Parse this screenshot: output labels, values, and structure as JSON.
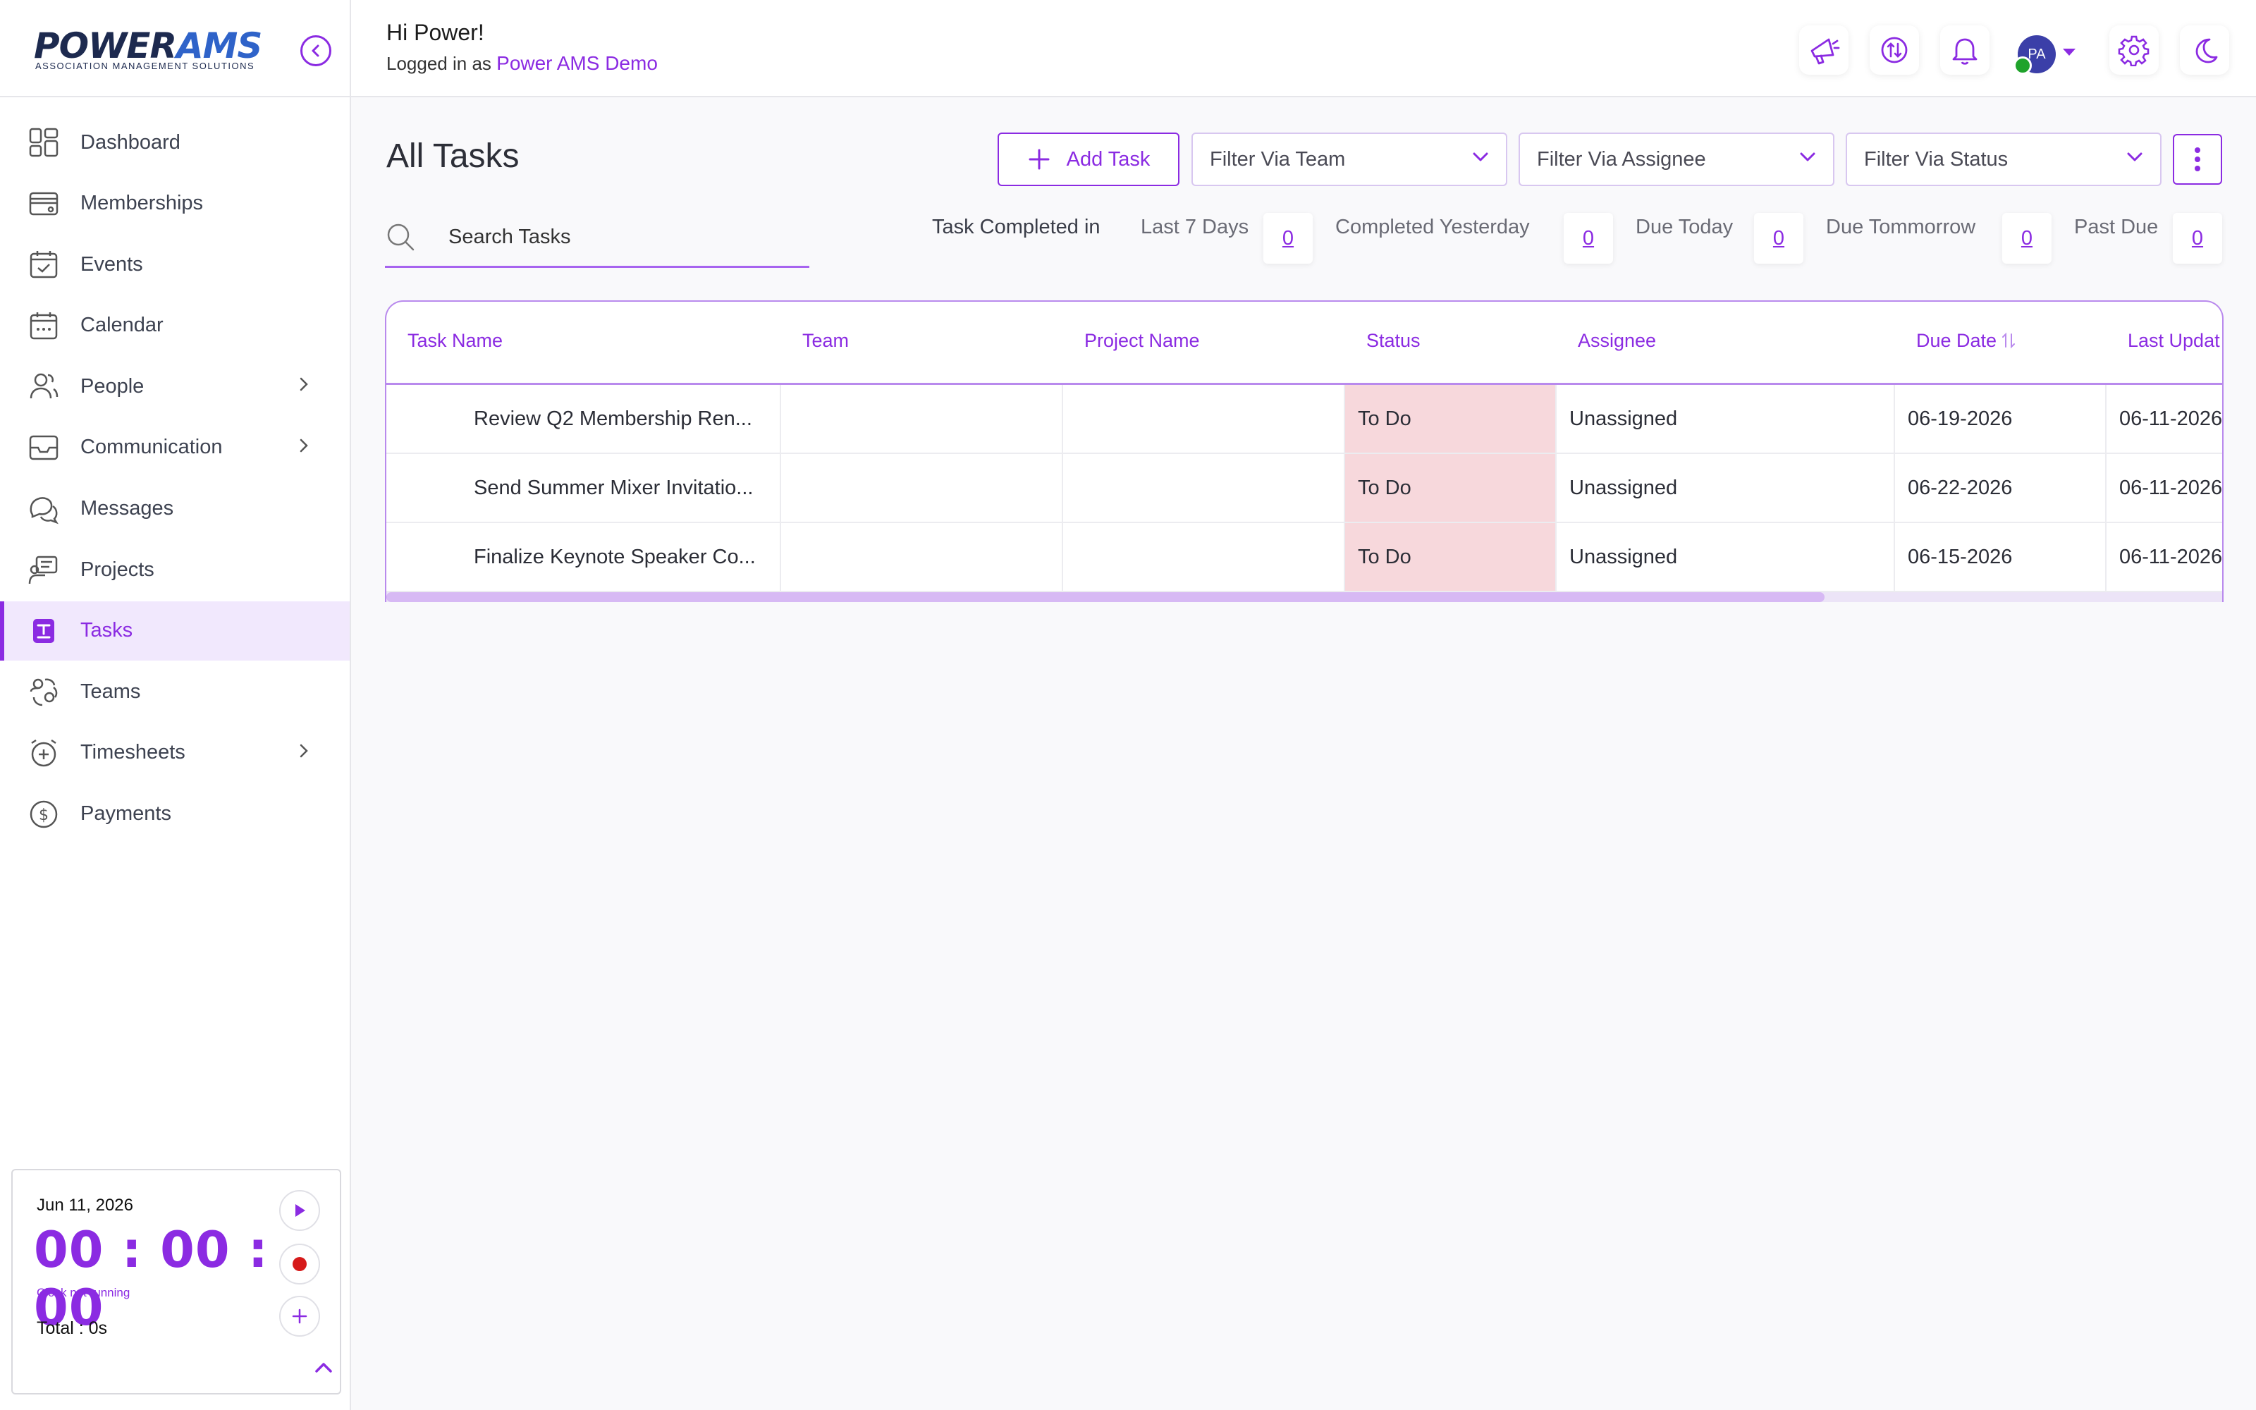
{
  "brand": {
    "name_part1": "POWER",
    "name_part2": "AMS",
    "tagline": "ASSOCIATION MANAGEMENT SOLUTIONS"
  },
  "header": {
    "greeting": "Hi Power!",
    "logged_in_prefix": "Logged in as",
    "logged_in_name": "Power AMS Demo",
    "avatar_initials": "PA"
  },
  "sidebar": {
    "items": [
      {
        "label": "Dashboard",
        "icon": "dashboard-icon"
      },
      {
        "label": "Memberships",
        "icon": "membership-card-icon"
      },
      {
        "label": "Events",
        "icon": "events-calendar-icon"
      },
      {
        "label": "Calendar",
        "icon": "calendar-icon"
      },
      {
        "label": "People",
        "icon": "people-icon",
        "has_submenu": true
      },
      {
        "label": "Communication",
        "icon": "mail-icon",
        "has_submenu": true
      },
      {
        "label": "Messages",
        "icon": "chat-icon"
      },
      {
        "label": "Projects",
        "icon": "projects-icon"
      },
      {
        "label": "Tasks",
        "icon": "tasks-icon",
        "active": true
      },
      {
        "label": "Teams",
        "icon": "teams-icon"
      },
      {
        "label": "Timesheets",
        "icon": "timesheet-icon",
        "has_submenu": true
      },
      {
        "label": "Payments",
        "icon": "dollar-icon"
      }
    ]
  },
  "timer": {
    "date": "Jun 11, 2026",
    "clock": "00 : 00 : 00",
    "state": "Clock not running",
    "total": "Total : 0s"
  },
  "main": {
    "title": "All Tasks",
    "add_task_label": "Add Task",
    "filters": [
      "Filter Via Team",
      "Filter Via Assignee",
      "Filter Via Status"
    ],
    "search_placeholder": "Search Tasks",
    "stats_lead": "Task Completed in",
    "stats": [
      {
        "label": "Last 7 Days",
        "value": "0"
      },
      {
        "label": "Completed Yesterday",
        "value": "0"
      },
      {
        "label": "Due Today",
        "value": "0"
      },
      {
        "label": "Due Tommorrow",
        "value": "0"
      },
      {
        "label": "Past Due",
        "value": "0"
      }
    ]
  },
  "table": {
    "columns": [
      "Task Name",
      "Team",
      "Project Name",
      "Status",
      "Assignee",
      "Due Date",
      "Last Updat"
    ],
    "sort_icon": "sort-arrows-icon",
    "rows": [
      {
        "task": "Review Q2 Membership Ren...",
        "team": "",
        "project": "",
        "status": "To Do",
        "assignee": "Unassigned",
        "due": "06-19-2026",
        "updated": "06-11-2026"
      },
      {
        "task": "Send Summer Mixer Invitatio...",
        "team": "",
        "project": "",
        "status": "To Do",
        "assignee": "Unassigned",
        "due": "06-22-2026",
        "updated": "06-11-2026"
      },
      {
        "task": "Finalize Keynote Speaker Co...",
        "team": "",
        "project": "",
        "status": "To Do",
        "assignee": "Unassigned",
        "due": "06-15-2026",
        "updated": "06-11-2026"
      }
    ],
    "status_color": "#f7d8dc"
  },
  "colors": {
    "accent": "#8b2be2",
    "online": "#1fa32b",
    "avatar": "#3b3fa8",
    "record": "#d61a1a"
  }
}
